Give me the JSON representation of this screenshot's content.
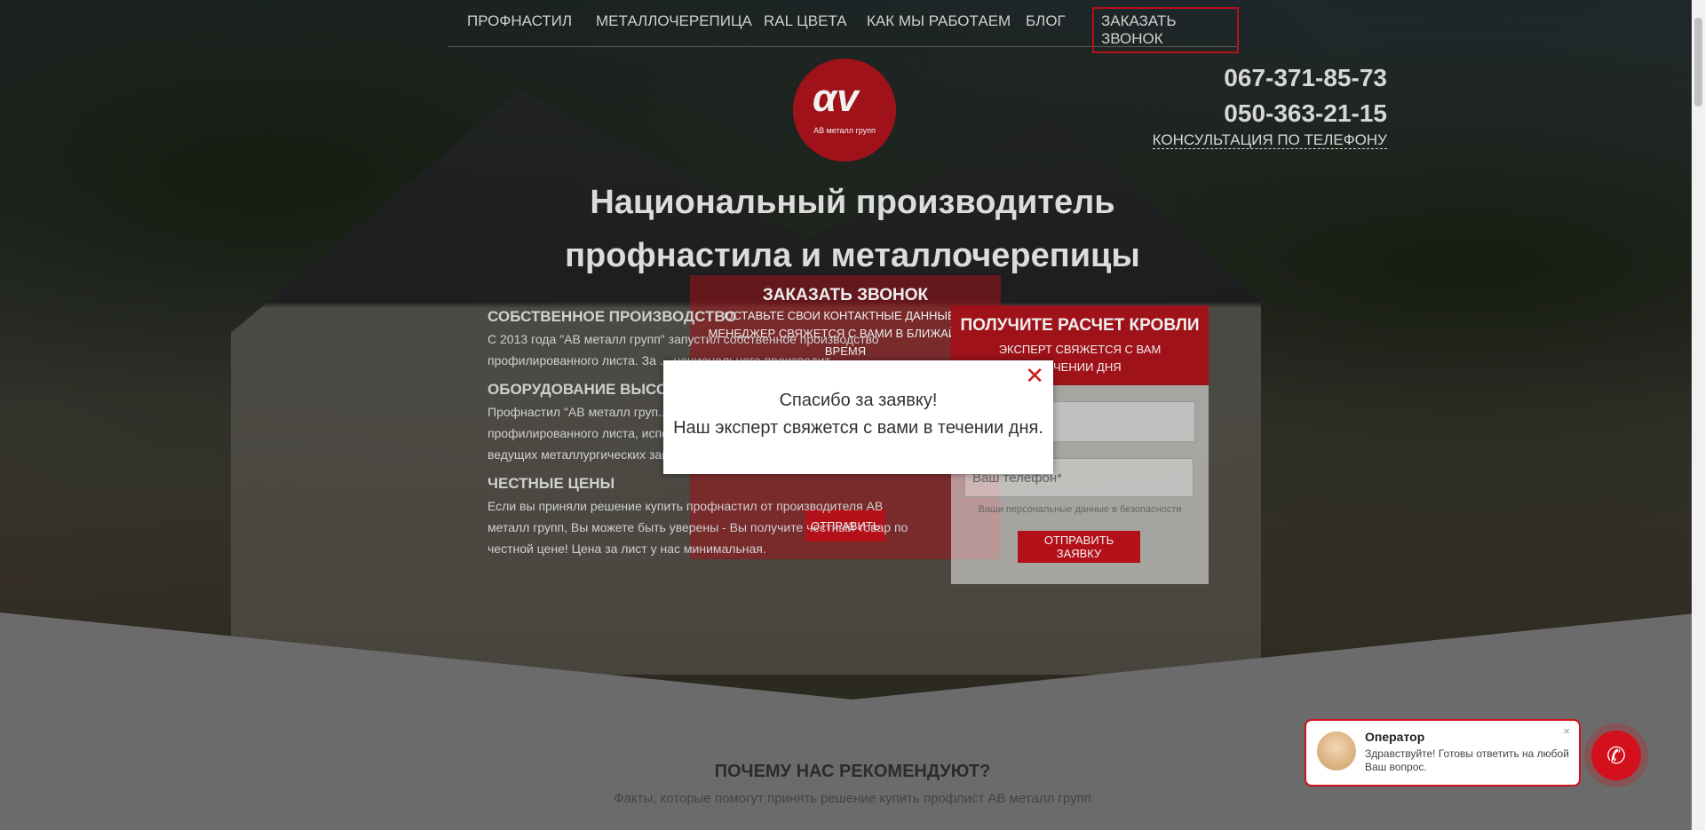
{
  "nav": {
    "items": [
      "ПРОФНАСТИЛ",
      "МЕТАЛЛОЧЕРЕПИЦА",
      "RAL ЦВЕТА",
      "КАК МЫ РАБОТАЕМ",
      "БЛОГ"
    ],
    "cta": "ЗАКАЗАТЬ ЗВОНОК"
  },
  "logo": {
    "mark": "αv",
    "text": "АВ металл групп"
  },
  "phones": {
    "p1": "067-371-85-73",
    "p2": "050-363-21-15",
    "consult": "КОНСУЛЬТАЦИЯ ПО ТЕЛЕФОНУ"
  },
  "headline": {
    "line1": "Национальный производитель",
    "line2": "профнастила и металлочерепицы"
  },
  "call_form": {
    "title": "ЗАКАЗАТЬ ЗВОНОК",
    "subtitle1": "ОСТАВЬТЕ СВОИ КОНТАКТНЫЕ ДАННЫЕ И",
    "subtitle2": "МЕНЕДЖЕР СВЯЖЕТСЯ С ВАМИ В БЛИЖАЙШЕЕ ВРЕМЯ",
    "button": "ОТПРАВИТЬ"
  },
  "features": [
    {
      "title": "СОБСТВЕННОЕ ПРОИЗВОДСТВО",
      "text": "С 2013 года \"АВ металл групп\" запустил собственное производство профилированного листа. За ... национального производит..."
    },
    {
      "title": "ОБОРУДОВАНИЕ ВЫСОКО...",
      "text": "Профнастил \"АВ металл груп... оборудовании украинского ... профилированного листа, используется высококачественное сырье ведущих металлургических заводов всего мира."
    },
    {
      "title": "ЧЕСТНЫЕ ЦЕНЫ",
      "text": "Если вы приняли решение купить профнастил от производителя АВ металл групп, Вы можете быть уверены - Вы получите честный товар по честной цене! Цена за лист у нас минимальная."
    }
  ],
  "calc": {
    "title": "ПОЛУЧИТЕ РАСЧЕТ КРОВЛИ",
    "subtitle1": "ЭКСПЕРТ СВЯЖЕТСЯ С ВАМ",
    "subtitle2": "ТЕЧЕНИИ ДНЯ",
    "phone_placeholder": "Ваш телефон*",
    "safe": "Ваши персональные данные в безопасности",
    "button": "ОТПРАВИТЬ ЗАЯВКУ"
  },
  "why": {
    "title": "ПОЧЕМУ НАС РЕКОМЕНДУЮТ?",
    "subtitle": "Факты, которые помогут принять решение купить профлист АВ металл групп"
  },
  "modal": {
    "line1": "Спасибо за заявку!",
    "line2": "Наш эксперт свяжется с вами в течении дня.",
    "close": "✕"
  },
  "chat": {
    "name": "Оператор",
    "text": "Здравствуйте! Готовы ответить на любой Ваш вопрос.",
    "close": "×"
  },
  "colors": {
    "accent": "#b3101a",
    "chat_red": "#d3101b"
  },
  "icons": {
    "close": "close-icon",
    "phone": "phone-icon"
  }
}
